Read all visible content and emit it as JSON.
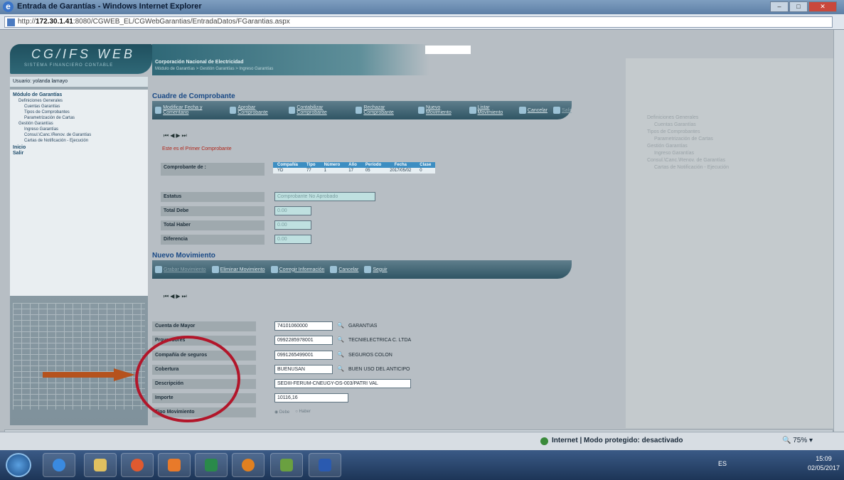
{
  "window": {
    "title": "Entrada de Garantías - Windows Internet Explorer"
  },
  "address": {
    "prefix": "http://",
    "host": "172.30.1.41",
    "path": ":8080/CGWEB_EL/CGWebGarantias/EntradaDatos/FGarantias.aspx"
  },
  "app": {
    "logo": "CG/IFS WEB",
    "logo_sub": "SISTEMA FINANCIERO CONTABLE",
    "org": "Corporación Nacional de Electricidad",
    "breadcrumb": "Módulo de Garantías > Gestión Garantías > Ingreso Garantías"
  },
  "sidebar": {
    "user": "Usuario: yolanda lamayo",
    "items": [
      {
        "label": "Módulo de Garantías",
        "level": 0
      },
      {
        "label": "Definiciones Generales",
        "level": 1
      },
      {
        "label": "Cuentas Garantías",
        "level": 2
      },
      {
        "label": "Tipos de Comprobantes",
        "level": 2
      },
      {
        "label": "Parametrización de Cartas",
        "level": 2
      },
      {
        "label": "Gestión Garantías",
        "level": 1
      },
      {
        "label": "Ingreso Garantías",
        "level": 2
      },
      {
        "label": "Consul.\\Canc.\\Renov. de Garantías",
        "level": 2
      },
      {
        "label": "Cartas de Notificación - Ejecución",
        "level": 2
      },
      {
        "label": "Inicio",
        "level": 0
      },
      {
        "label": "Salir",
        "level": 0
      }
    ]
  },
  "comprobante": {
    "title": "Cuadre de Comprobante",
    "toolbar": [
      {
        "label": "Modificar Fecha y Comentario",
        "icon": "edit-icon",
        "dim": false
      },
      {
        "label": "Aprobar Comprobante",
        "icon": "check-icon",
        "dim": false
      },
      {
        "label": "Contabilizar Comprobante",
        "icon": "ledger-icon",
        "dim": false
      },
      {
        "label": "Rechazar Comprobante",
        "icon": "reject-icon",
        "dim": false
      },
      {
        "label": "Nuevo Movimiento",
        "icon": "new-icon",
        "dim": false
      },
      {
        "label": "Listar Movimiento",
        "icon": "list-icon",
        "dim": false
      },
      {
        "label": "Cancelar",
        "icon": "cancel-icon",
        "dim": false
      },
      {
        "label": "Salir",
        "icon": "exit-icon",
        "dim": true
      }
    ],
    "message": "Este es el Primer Comprobante",
    "comp_label": "Comprobante de :",
    "table": {
      "headers": [
        "Compañía",
        "Tipo",
        "Número",
        "Año",
        "Período",
        "Fecha",
        "Clase"
      ],
      "row": [
        "YD",
        "77",
        "1",
        "17",
        "05",
        "2017/05/02",
        "0"
      ]
    },
    "fields": [
      {
        "label": "Estatus",
        "value": "Comprobante No Aprobado"
      },
      {
        "label": "Total Debe",
        "value": "0.00"
      },
      {
        "label": "Total Haber",
        "value": "0.00"
      },
      {
        "label": "Diferencia",
        "value": "0.00"
      }
    ]
  },
  "movimiento": {
    "title": "Nuevo Movimiento",
    "toolbar": [
      {
        "label": "Grabar Movimiento",
        "icon": "save-icon",
        "dim": true
      },
      {
        "label": "Eliminar Movimiento",
        "icon": "delete-icon",
        "dim": false
      },
      {
        "label": "Corregir Información",
        "icon": "correct-icon",
        "dim": false
      },
      {
        "label": "Cancelar",
        "icon": "cancel-icon",
        "dim": false
      },
      {
        "label": "Seguir",
        "icon": "next-icon",
        "dim": false
      }
    ],
    "fields": [
      {
        "label": "Cuenta de Mayor",
        "value": "74101060000",
        "desc": "GARANTIAS"
      },
      {
        "label": "Proveedores",
        "value": "0992285978001",
        "desc": "TECNIELECTRICA C. LTDA"
      },
      {
        "label": "Compañía de seguros",
        "value": "0991265499001",
        "desc": "SEGUROS COLON"
      },
      {
        "label": "Cobertura",
        "value": "BUENUSAN",
        "desc": "BUEN USO DEL ANTICIPO"
      },
      {
        "label": "Descripción",
        "value": "SEDIII-FERUM-CNEUGY-OS-003/PATRI VAL",
        "desc": ""
      },
      {
        "label": "Importe",
        "value": "10116,16",
        "desc": ""
      },
      {
        "label": "Tipo Movimiento",
        "value": "",
        "desc": ""
      }
    ],
    "radio_options": [
      "Debe",
      "Haber"
    ]
  },
  "faded_window": {
    "lines": [
      "Definiciones Generales",
      "Cuentas Garantías",
      "Tipos de Comprobantes",
      "Parametrización de Cartas",
      "Gestión Garantías",
      "Ingreso Garantías",
      "Consul.\\Canc.\\Renov. de Garantías",
      "Cartas de Notificación - Ejecución"
    ]
  },
  "status": {
    "zone": "Internet | Modo protegido: desactivado",
    "zoom": "75%"
  },
  "taskbar": {
    "lang": "ES",
    "time": "15:09",
    "date": "02/05/2017"
  },
  "colors": {
    "toolbar": "#2f5564",
    "accent": "#1a4a86",
    "annotation": "#b2162a",
    "arrow": "#b5521d"
  }
}
